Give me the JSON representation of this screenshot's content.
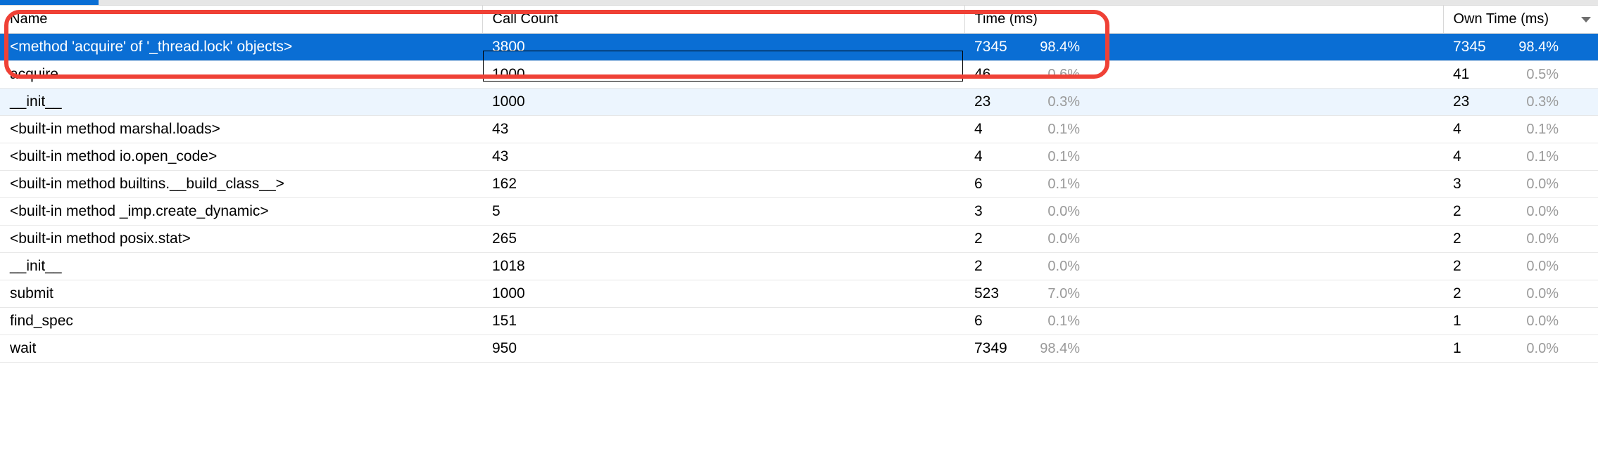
{
  "colors": {
    "accent": "#0a6ed4",
    "callout": "#ef4136"
  },
  "sort": {
    "column": "own_time",
    "direction": "desc"
  },
  "columns": {
    "name": "Name",
    "call_count": "Call Count",
    "time_ms": "Time (ms)",
    "own_time_ms": "Own Time (ms)"
  },
  "rows": [
    {
      "name": "<method 'acquire' of '_thread.lock' objects>",
      "call_count": "3800",
      "time_ms": "7345",
      "time_pct": "98.4%",
      "own_ms": "7345",
      "own_pct": "98.4%",
      "selected": true
    },
    {
      "name": "acquire",
      "call_count": "1000",
      "time_ms": "46",
      "time_pct": "0.6%",
      "own_ms": "41",
      "own_pct": "0.5%"
    },
    {
      "name": "__init__",
      "call_count": "1000",
      "time_ms": "23",
      "time_pct": "0.3%",
      "own_ms": "23",
      "own_pct": "0.3%",
      "hover": true
    },
    {
      "name": "<built-in method marshal.loads>",
      "call_count": "43",
      "time_ms": "4",
      "time_pct": "0.1%",
      "own_ms": "4",
      "own_pct": "0.1%"
    },
    {
      "name": "<built-in method io.open_code>",
      "call_count": "43",
      "time_ms": "4",
      "time_pct": "0.1%",
      "own_ms": "4",
      "own_pct": "0.1%"
    },
    {
      "name": "<built-in method builtins.__build_class__>",
      "call_count": "162",
      "time_ms": "6",
      "time_pct": "0.1%",
      "own_ms": "3",
      "own_pct": "0.0%"
    },
    {
      "name": "<built-in method _imp.create_dynamic>",
      "call_count": "5",
      "time_ms": "3",
      "time_pct": "0.0%",
      "own_ms": "2",
      "own_pct": "0.0%"
    },
    {
      "name": "<built-in method posix.stat>",
      "call_count": "265",
      "time_ms": "2",
      "time_pct": "0.0%",
      "own_ms": "2",
      "own_pct": "0.0%"
    },
    {
      "name": "__init__",
      "call_count": "1018",
      "time_ms": "2",
      "time_pct": "0.0%",
      "own_ms": "2",
      "own_pct": "0.0%"
    },
    {
      "name": "submit",
      "call_count": "1000",
      "time_ms": "523",
      "time_pct": "7.0%",
      "own_ms": "2",
      "own_pct": "0.0%"
    },
    {
      "name": "find_spec",
      "call_count": "151",
      "time_ms": "6",
      "time_pct": "0.1%",
      "own_ms": "1",
      "own_pct": "0.0%"
    },
    {
      "name": "wait",
      "call_count": "950",
      "time_ms": "7349",
      "time_pct": "98.4%",
      "own_ms": "1",
      "own_pct": "0.0%"
    }
  ]
}
